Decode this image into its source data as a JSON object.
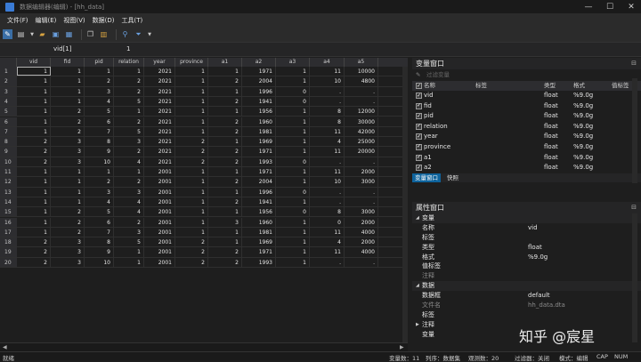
{
  "window": {
    "title": "数据编辑器(编辑) - [hh_data]",
    "minimize": "—",
    "maximize": "☐",
    "close": "✕"
  },
  "menu": [
    "文件(F)",
    "编辑(E)",
    "视图(V)",
    "数据(D)",
    "工具(T)"
  ],
  "command": {
    "varname": "vid[1]",
    "value": "1"
  },
  "grid": {
    "columns": [
      "vid",
      "fid",
      "pid",
      "relation",
      "year",
      "province",
      "a1",
      "a2",
      "a3",
      "a4",
      "a5"
    ],
    "rows": [
      [
        "1",
        "1",
        "1",
        "1",
        "2021",
        "1",
        "1",
        "1971",
        "1",
        "11",
        "10000"
      ],
      [
        "1",
        "1",
        "2",
        "2",
        "2021",
        "1",
        "2",
        "2004",
        "1",
        "10",
        "4800"
      ],
      [
        "1",
        "1",
        "3",
        "2",
        "2021",
        "1",
        "1",
        "1996",
        "0",
        ".",
        "."
      ],
      [
        "1",
        "1",
        "4",
        "5",
        "2021",
        "1",
        "2",
        "1941",
        "0",
        ".",
        "."
      ],
      [
        "1",
        "2",
        "5",
        "1",
        "2021",
        "1",
        "1",
        "1956",
        "1",
        "8",
        "12000"
      ],
      [
        "1",
        "2",
        "6",
        "2",
        "2021",
        "1",
        "2",
        "1960",
        "1",
        "8",
        "30000"
      ],
      [
        "1",
        "2",
        "7",
        "5",
        "2021",
        "1",
        "2",
        "1981",
        "1",
        "11",
        "42000"
      ],
      [
        "2",
        "3",
        "8",
        "3",
        "2021",
        "2",
        "1",
        "1969",
        "1",
        "4",
        "25000"
      ],
      [
        "2",
        "3",
        "9",
        "2",
        "2021",
        "2",
        "2",
        "1971",
        "1",
        "11",
        "20000"
      ],
      [
        "2",
        "3",
        "10",
        "4",
        "2021",
        "2",
        "2",
        "1993",
        "0",
        ".",
        "."
      ],
      [
        "1",
        "1",
        "1",
        "1",
        "2001",
        "1",
        "1",
        "1971",
        "1",
        "11",
        "2000"
      ],
      [
        "1",
        "1",
        "2",
        "2",
        "2001",
        "1",
        "2",
        "2004",
        "1",
        "10",
        "3000"
      ],
      [
        "1",
        "1",
        "3",
        "3",
        "2001",
        "1",
        "1",
        "1996",
        "0",
        ".",
        "."
      ],
      [
        "1",
        "1",
        "4",
        "4",
        "2001",
        "1",
        "2",
        "1941",
        "1",
        ".",
        "."
      ],
      [
        "1",
        "2",
        "5",
        "4",
        "2001",
        "1",
        "1",
        "1956",
        "0",
        "8",
        "3000"
      ],
      [
        "1",
        "2",
        "6",
        "2",
        "2001",
        "1",
        "3",
        "1960",
        "1",
        "0",
        "2000"
      ],
      [
        "1",
        "2",
        "7",
        "3",
        "2001",
        "1",
        "1",
        "1981",
        "1",
        "11",
        "4000"
      ],
      [
        "2",
        "3",
        "8",
        "5",
        "2001",
        "2",
        "1",
        "1969",
        "1",
        "4",
        "2000"
      ],
      [
        "2",
        "3",
        "9",
        "1",
        "2001",
        "2",
        "2",
        "1971",
        "1",
        "11",
        "4000"
      ],
      [
        "2",
        "3",
        "10",
        "1",
        "2001",
        "2",
        "2",
        "1993",
        "1",
        ".",
        "."
      ]
    ]
  },
  "variables_panel": {
    "title": "变量窗口",
    "filter_placeholder": "过滤变量",
    "headers": {
      "name": "名称",
      "label": "标签",
      "type": "类型",
      "format": "格式",
      "value_label": "值标签"
    },
    "items": [
      {
        "name": "vid",
        "type": "float",
        "format": "%9.0g"
      },
      {
        "name": "fid",
        "type": "float",
        "format": "%9.0g"
      },
      {
        "name": "pid",
        "type": "float",
        "format": "%9.0g"
      },
      {
        "name": "relation",
        "type": "float",
        "format": "%9.0g"
      },
      {
        "name": "year",
        "type": "float",
        "format": "%9.0g"
      },
      {
        "name": "province",
        "type": "float",
        "format": "%9.0g"
      },
      {
        "name": "a1",
        "type": "float",
        "format": "%9.0g"
      },
      {
        "name": "a2",
        "type": "float",
        "format": "%9.0g"
      }
    ],
    "tabs": [
      "变量窗口",
      "快照"
    ]
  },
  "properties_panel": {
    "title": "属性窗口",
    "rows": [
      {
        "group": true,
        "k": "变量"
      },
      {
        "k": "名称",
        "v": "vid"
      },
      {
        "k": "标签",
        "v": ""
      },
      {
        "k": "类型",
        "v": "float"
      },
      {
        "k": "格式",
        "v": "%9.0g"
      },
      {
        "k": "值标签",
        "v": ""
      },
      {
        "k": "注释",
        "v": "",
        "dim": true
      },
      {
        "group": true,
        "k": "数据"
      },
      {
        "k": "数据框",
        "v": "default"
      },
      {
        "k": "文件名",
        "v": "hh_data.dta",
        "dim": true
      },
      {
        "k": "标签",
        "v": ""
      },
      {
        "k": "注释",
        "v": "",
        "tri": true
      },
      {
        "k": "变量",
        "v": ""
      }
    ]
  },
  "status": {
    "left": "就绪",
    "vars": "变量数：11",
    "order": "列序：数据集",
    "obs": "观测数：20",
    "filter": "过滤器：关闭",
    "mode": "模式：编辑",
    "cap": "CAP",
    "num": "NUM"
  },
  "watermark": "知乎 @宸星",
  "colors": {
    "accent": "#0e639c",
    "background": "#1e1e1e"
  }
}
